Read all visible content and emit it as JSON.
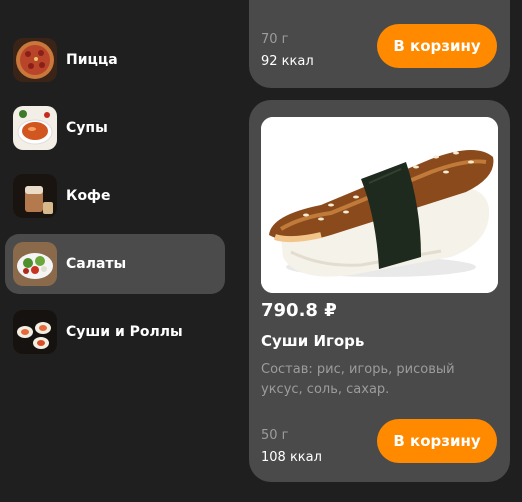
{
  "sidebar": {
    "items": [
      {
        "label": "Пицца",
        "icon": "pizza-icon"
      },
      {
        "label": "Супы",
        "icon": "soup-icon"
      },
      {
        "label": "Кофе",
        "icon": "coffee-icon"
      },
      {
        "label": "Салаты",
        "icon": "salad-icon",
        "active": true
      },
      {
        "label": "Суши и Роллы",
        "icon": "sushi-icon"
      }
    ]
  },
  "cards": {
    "top": {
      "weight": "70 г",
      "kcal": "92 ккал",
      "button_label": "В корзину"
    },
    "main": {
      "price": "790.8 ₽",
      "name": "Суши Игорь",
      "description": "Состав: рис, игорь, рисовый уксус, соль, сахар.",
      "weight": "50 г",
      "kcal": "108 ккал",
      "button_label": "В корзину"
    }
  },
  "colors": {
    "background": "#1f1f1f",
    "card": "#4a4a4a",
    "active_category": "#4b4b4b",
    "accent": "#ff8a00",
    "muted_text": "#9c9c9c"
  }
}
